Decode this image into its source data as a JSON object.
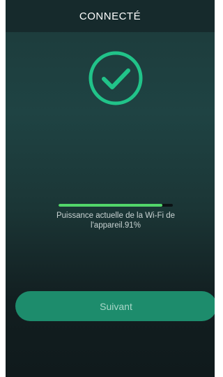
{
  "header": {
    "title": "CONNECTÉ"
  },
  "status": {
    "icon": "check-circle-icon",
    "color": "#21c389"
  },
  "wifi": {
    "strength_text": "Puissance actuelle de la Wi-Fi de l'appareil.91%",
    "strength_percent": 91,
    "bar_color": "#52d66a"
  },
  "actions": {
    "next_label": "Suivant",
    "button_color": "#1d8c6c"
  }
}
